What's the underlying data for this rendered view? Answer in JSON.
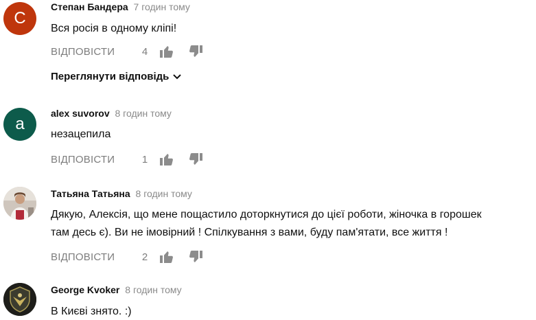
{
  "comments": [
    {
      "author": "Степан Бандера",
      "time": "7 годин тому",
      "avatar_letter": "С",
      "avatar_color": "#bf360c",
      "text_lines": [
        "Вся росія в одному кліпі!"
      ],
      "reply_label": "ВІДПОВІСТИ",
      "likes": "4",
      "view_replies": "Переглянути відповідь"
    },
    {
      "author": "alex suvorov",
      "time": "8 годин тому",
      "avatar_letter": "a",
      "avatar_color": "#0d5b4b",
      "text_lines": [
        "незацепила"
      ],
      "reply_label": "ВІДПОВІСТИ",
      "likes": "1"
    },
    {
      "author": "Татьяна Татьяна",
      "time": "8 годин тому",
      "avatar_letter": "",
      "avatar_color": "#d8cfc6",
      "text_lines": [
        "Дякую, Алексія, що мене пощастило доторкнутися до цієї роботи, жіночка в горошек",
        "там десь є). Ви не імовірний ! Спілкування з вами,  буду пам'ятати,  все життя !"
      ],
      "reply_label": "ВІДПОВІСТИ",
      "likes": "2"
    },
    {
      "author": "George Kvoker",
      "time": "8 годин тому",
      "avatar_letter": "",
      "avatar_color": "#2a2a24",
      "text_lines": [
        "В Києві знято. :)"
      ]
    }
  ],
  "icons": {
    "like": "thumbs-up-icon",
    "dislike": "thumbs-down-icon",
    "chevron": "chevron-down-icon"
  }
}
